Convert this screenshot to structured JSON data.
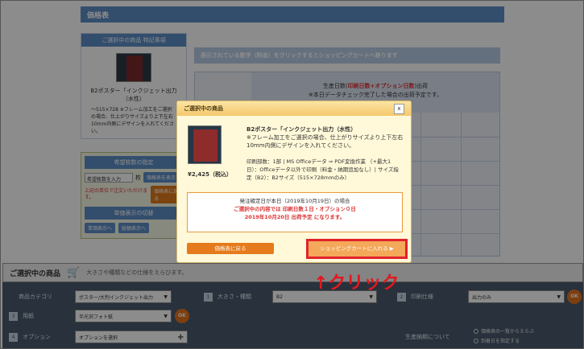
{
  "page": {
    "header_title": "価格表"
  },
  "left_panel": {
    "heading": "ご選択中の商品 特記事項",
    "product_name": "B2ポスター「インクジェット出力（水性）",
    "specs": "～515×728\n※フレーム加工をご選択の場合、仕上がりサイズより上下左右10mm内側にデザインを入れてください。"
  },
  "qty_panel": {
    "heading": "希望枚数の指定",
    "input_placeholder": "希望枚数を入力",
    "unit": "枚",
    "show_button": "価格表を表示",
    "note": "上記の単位で注文いただけます。",
    "back_button": "価格表に戻る",
    "toggle_heading": "単価表示の切替",
    "btn_unit": "単価表示へ",
    "btn_total": "総額表示へ"
  },
  "price_table": {
    "hint": "表示されている数字（料金）をクリックするとショッピングカートへ移ります",
    "head_line1": "生産日数(",
    "head_red": "印刷日数+オプション日数",
    "head_line1_end": ")出荷",
    "head_line2": "※本日データチェック完了した場合の出荷予定です。"
  },
  "bottom": {
    "title": "ご選択中の商品",
    "placeholder": "大きさや種類などの仕様をえらびます。",
    "category_label": "商品カテゴリ",
    "category_value": "ポスター/大判インクジェット出力",
    "size_num": "1",
    "size_label": "大きさ・種類",
    "size_value": "B2",
    "print_num": "2",
    "print_label": "印刷仕様",
    "print_value": "出力のみ",
    "paper_num": "3",
    "paper_label": "用紙",
    "paper_value": "半光沢フォト紙",
    "option_num": "4",
    "option_label": "オプション",
    "option_value": "オプションを選択",
    "delivery_label": "生産納期について",
    "radio1": "価格表の一覧からえらぶ",
    "radio2": "到着日を指定する",
    "ok": "OK"
  },
  "modal": {
    "title": "ご選択中の商品",
    "close": "x",
    "product_title": "B2ポスター「インクジェット出力（水性）",
    "product_note": "※フレーム加工をご選択の場合、仕上がりサイズより上下左右10mm内側にデザインを入れてください。",
    "details": "印刷部数：1部 | MS Officeデータ ⇒ PDF変換作業 （+最大1日）：Officeデータ以外で印刷（料金・納期追加なし）| サイズ指定（B2）：B2サイズ（515×728mmのみ）",
    "price": "¥2,425（税込）",
    "box_line1": "発注確定日が本日（2019年10月19日）の場合",
    "box_line2": "ご選択中の内容では 印刷日数１日・オプション０日",
    "box_line3": "2019年10月20日 出荷予定 になります。",
    "back_button": "価格表に戻る",
    "cart_button": "ショッピングカートに入れる ▶"
  },
  "annotation": {
    "click_label": "↑クリック"
  }
}
